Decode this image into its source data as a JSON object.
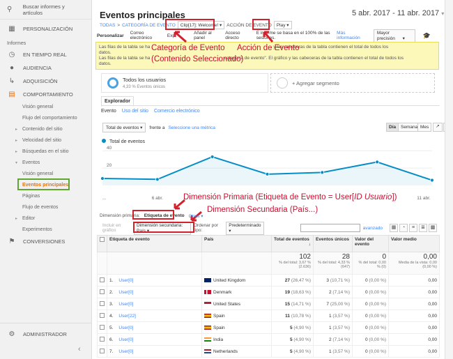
{
  "sidebar": {
    "search": "Buscar informes y artículos",
    "items_top": [
      {
        "icon": "dashboard-icon",
        "label": "PERSONALIZACIÓN"
      }
    ],
    "section": "Informes",
    "items": [
      {
        "icon": "clock-icon",
        "label": "EN TIEMPO REAL"
      },
      {
        "icon": "person-icon",
        "label": "AUDIENCIA"
      },
      {
        "icon": "flow-icon",
        "label": "ADQUISICIÓN"
      },
      {
        "icon": "calendar-icon",
        "label": "COMPORTAMIENTO"
      }
    ],
    "behavior_sub": [
      "Visión general",
      "Flujo del comportamiento",
      "Contenido del sitio",
      "Velocidad del sitio",
      "Búsquedas en el sitio",
      "Eventos"
    ],
    "events_sub": [
      "Visión general",
      "Eventos principales",
      "Páginas",
      "Flujo de eventos"
    ],
    "after": [
      "Editor",
      "Experimentos"
    ],
    "conversions": "CONVERSIONES",
    "admin": "ADMINISTRADOR"
  },
  "header": {
    "title": "Eventos principales",
    "date_range": "5 abr. 2017 - 11 abr. 2017",
    "breadcrumb": [
      "TODAS",
      "CATEGORÍA DE EVENTO",
      "Clip[17]: Welcome!",
      "ACCIÓN DE EVENTO",
      "Play"
    ]
  },
  "toolbar": {
    "customize": "Personalizar",
    "email": "Correo electrónico",
    "export": "Exp",
    "add_panel": "Añadir al panel",
    "direct": "Acceso directo",
    "sample": "E  informe se basa en el 100% de las sesiones.",
    "more_info": "Más información",
    "precision": "Mayor precisión"
  },
  "message": {
    "line1": "Las filas de la tabla se ha                                                                                                  y las cabeceras de la tabla contienen el total de todos los",
    "line1b": "datos.",
    "line2": "Las filas de la tabla se ha                                                           categoría de evento\". El gráfico y las cabeceras de la tabla contienen el total de todos los",
    "line2b": "datos."
  },
  "segments": {
    "all_users": "Todos los usuarios",
    "all_users_sub": "4,33 % Eventos únicos",
    "add": "+ Agregar segmento"
  },
  "explorer": {
    "tab": "Explorador",
    "subtabs": [
      "Evento",
      "Uso del sitio",
      "Comercio electrónico"
    ],
    "metric": "Total de eventos",
    "versus": "frente a",
    "select_metric": "Seleccione una métrica",
    "periods": [
      "Día",
      "Semana",
      "Mes"
    ]
  },
  "chart_data": {
    "type": "line",
    "series": [
      {
        "name": "Total de eventos",
        "values": [
          8,
          7,
          33,
          13,
          15,
          27,
          6
        ]
      }
    ],
    "x": [
      "5 abr.",
      "6 abr.",
      "7 abr.",
      "8 abr.",
      "9 abr.",
      "10 abr.",
      "11 abr."
    ],
    "x_ticks": [
      "...",
      "6 abr.",
      "",
      "",
      "",
      "",
      "11 abr."
    ],
    "y_ticks": [
      "40",
      "20"
    ],
    "ylim": [
      0,
      45
    ],
    "color": "#058dc7"
  },
  "annotations": {
    "cat": "Categoría de Evento",
    "cat2": "(Contenido Seleccionado)",
    "act": "Acción de Evento",
    "dim1": "Dimensión Primaria (Etiqueta de Evento = User[",
    "dim1i": "ID Usuario",
    "dim1c": "])",
    "dim2": "Dimensión Secundaria (País...)"
  },
  "dimensions": {
    "primary_label": "Dimensión primaria:",
    "primary_value": "Etiqueta de evento",
    "others": "Otros",
    "graph_rows": "Incluir en gráfico",
    "secondary": "Dimensión secundaria: País",
    "sort_label": "Ordenar por tipo:",
    "sort_value": "Predeterminado",
    "advanced": "avanzado"
  },
  "table": {
    "headers": [
      "Etiqueta de evento",
      "País",
      "Total de eventos",
      "Eventos únicos",
      "Valor del evento",
      "Valor medio"
    ],
    "totals": {
      "total": "102",
      "total_sub": "% del total: 3,67 % (2.636)",
      "unique": "28",
      "unique_sub": "% del total: 4,33 % (647)",
      "value": "0",
      "value_sub": "% del total: 0,00 % (0)",
      "avg": "0,00",
      "avg_sub": "Media de la vista: 0,00 (0,00 %)"
    },
    "rows": [
      {
        "n": "1.",
        "label": "User[0]",
        "country": "United Kingdom",
        "flag": "uk",
        "total": "27",
        "total_pct": "(26,47 %)",
        "unique": "3",
        "unique_pct": "(10,71 %)",
        "value": "0",
        "value_pct": "(0,00 %)",
        "avg": "0,00"
      },
      {
        "n": "2.",
        "label": "User[0]",
        "country": "Denmark",
        "flag": "dk",
        "total": "19",
        "total_pct": "(18,63 %)",
        "unique": "2",
        "unique_pct": "(7,14 %)",
        "value": "0",
        "value_pct": "(0,00 %)",
        "avg": "0,00"
      },
      {
        "n": "3.",
        "label": "User[0]",
        "country": "United States",
        "flag": "us",
        "total": "15",
        "total_pct": "(14,71 %)",
        "unique": "7",
        "unique_pct": "(25,00 %)",
        "value": "0",
        "value_pct": "(0,00 %)",
        "avg": "0,00"
      },
      {
        "n": "4.",
        "label": "User[22]",
        "country": "Spain",
        "flag": "es",
        "total": "11",
        "total_pct": "(10,78 %)",
        "unique": "1",
        "unique_pct": "(3,57 %)",
        "value": "0",
        "value_pct": "(0,00 %)",
        "avg": "0,00"
      },
      {
        "n": "5.",
        "label": "User[0]",
        "country": "Spain",
        "flag": "es",
        "total": "5",
        "total_pct": "(4,90 %)",
        "unique": "1",
        "unique_pct": "(3,57 %)",
        "value": "0",
        "value_pct": "(0,00 %)",
        "avg": "0,00"
      },
      {
        "n": "6.",
        "label": "User[0]",
        "country": "India",
        "flag": "in",
        "total": "5",
        "total_pct": "(4,90 %)",
        "unique": "2",
        "unique_pct": "(7,14 %)",
        "value": "0",
        "value_pct": "(0,00 %)",
        "avg": "0,00"
      },
      {
        "n": "7.",
        "label": "User[0]",
        "country": "Netherlands",
        "flag": "nl",
        "total": "5",
        "total_pct": "(4,90 %)",
        "unique": "1",
        "unique_pct": "(3,57 %)",
        "value": "0",
        "value_pct": "(0,00 %)",
        "avg": "0,00"
      }
    ]
  }
}
